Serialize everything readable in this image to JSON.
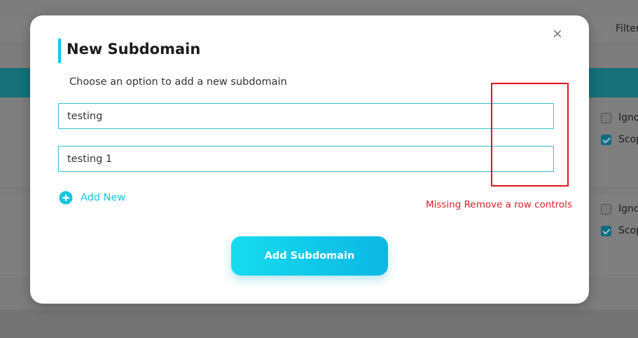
{
  "background": {
    "filter_label": "Filter",
    "rows": [
      {
        "ignore_label": "Igno",
        "ignore_checked": false,
        "scope_label": "Scop",
        "scope_checked": true
      },
      {
        "ignore_label": "Igno",
        "ignore_checked": false,
        "scope_label": "Scop",
        "scope_checked": true
      }
    ]
  },
  "modal": {
    "close_glyph": "×",
    "title": "New Subdomain",
    "subtitle": "Choose an option to add a new subdomain",
    "inputs": [
      {
        "value": "testing"
      },
      {
        "value": "testing 1"
      }
    ],
    "add_new_label": "Add New",
    "add_new_icon": "plus-circle-icon",
    "submit_label": "Add Subdomain"
  },
  "annotation": {
    "text": "Missing Remove a row controls",
    "color": "#e0131c"
  },
  "colors": {
    "accent": "#14c8e2",
    "button_gradient_start": "#17dcef",
    "button_gradient_end": "#0bb7e3",
    "overlay": "#7d7d7d"
  }
}
